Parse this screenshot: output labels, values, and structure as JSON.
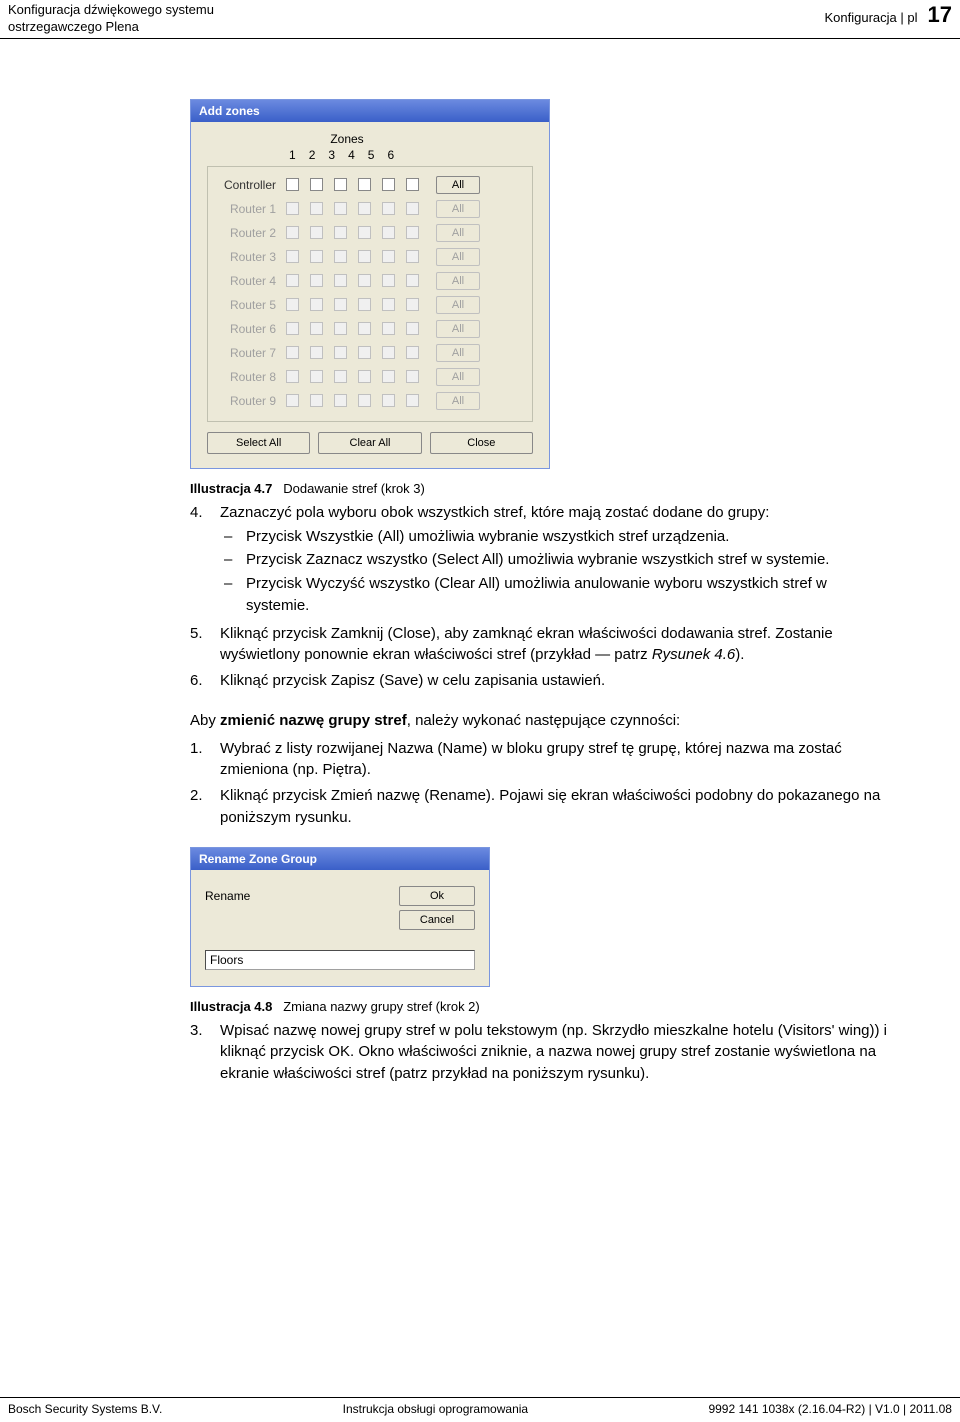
{
  "header": {
    "left_line1": "Konfiguracja dźwiękowego systemu",
    "left_line2": "ostrzegawczego Plena",
    "right_text": "Konfiguracja | pl",
    "page_number": "17"
  },
  "dialog_addzones": {
    "title": "Add zones",
    "zones_label": "Zones",
    "zone_numbers": [
      "1",
      "2",
      "3",
      "4",
      "5",
      "6"
    ],
    "rows": [
      {
        "label": "Controller",
        "enabled": true,
        "all": "All"
      },
      {
        "label": "Router 1",
        "enabled": false,
        "all": "All"
      },
      {
        "label": "Router 2",
        "enabled": false,
        "all": "All"
      },
      {
        "label": "Router 3",
        "enabled": false,
        "all": "All"
      },
      {
        "label": "Router 4",
        "enabled": false,
        "all": "All"
      },
      {
        "label": "Router 5",
        "enabled": false,
        "all": "All"
      },
      {
        "label": "Router 6",
        "enabled": false,
        "all": "All"
      },
      {
        "label": "Router 7",
        "enabled": false,
        "all": "All"
      },
      {
        "label": "Router 8",
        "enabled": false,
        "all": "All"
      },
      {
        "label": "Router 9",
        "enabled": false,
        "all": "All"
      }
    ],
    "btn_selectall": "Select All",
    "btn_clearall": "Clear All",
    "btn_close": "Close"
  },
  "caption1": {
    "prefix": "Illustracja 4.7",
    "text": "Dodawanie stref (krok 3)"
  },
  "step4": {
    "num": "4.",
    "text": "Zaznaczyć pola wyboru obok wszystkich stref, które mają zostać dodane do grupy:",
    "sub": [
      "Przycisk Wszystkie (All) umożliwia wybranie wszystkich stref urządzenia.",
      "Przycisk Zaznacz wszystko (Select All) umożliwia wybranie wszystkich stref w systemie.",
      "Przycisk Wyczyść wszystko (Clear All) umożliwia anulowanie wyboru wszystkich stref w systemie."
    ]
  },
  "step5": {
    "num": "5.",
    "text_a": "Kliknąć przycisk Zamknij (Close), aby zamknąć ekran właściwości dodawania stref. Zostanie wyświetlony ponownie ekran właściwości stref (przykład — patrz ",
    "text_ital": "Rysunek 4.6",
    "text_b": ")."
  },
  "step6": {
    "num": "6.",
    "text": "Kliknąć przycisk Zapisz (Save) w celu zapisania ustawień."
  },
  "para_change": {
    "pre": "Aby ",
    "bold": "zmienić nazwę grupy stref",
    "post": ", należy wykonać następujące czynności:"
  },
  "step_c1": {
    "num": "1.",
    "text": "Wybrać z listy rozwijanej Nazwa (Name) w bloku grupy stref tę grupę, której nazwa ma zostać zmieniona (np. Piętra)."
  },
  "step_c2": {
    "num": "2.",
    "text": "Kliknąć przycisk Zmień nazwę (Rename). Pojawi się ekran właściwości podobny do pokazanego na poniższym rysunku."
  },
  "dialog_rename": {
    "title": "Rename Zone Group",
    "label": "Rename",
    "ok": "Ok",
    "cancel": "Cancel",
    "value": "Floors"
  },
  "caption2": {
    "prefix": "Illustracja 4.8",
    "text": "Zmiana nazwy grupy stref (krok 2)"
  },
  "step_c3": {
    "num": "3.",
    "text": "Wpisać nazwę nowej grupy stref w polu tekstowym (np. Skrzydło mieszkalne hotelu (Visitors' wing)) i kliknąć przycisk OK. Okno właściwości zniknie, a nazwa nowej grupy stref zostanie wyświetlona na ekranie właściwości stref (patrz przykład na poniższym rysunku)."
  },
  "footer": {
    "left": "Bosch Security Systems B.V.",
    "center": "Instrukcja obsługi oprogramowania",
    "right": "9992 141 1038x (2.16.04-R2) | V1.0 | 2011.08"
  }
}
